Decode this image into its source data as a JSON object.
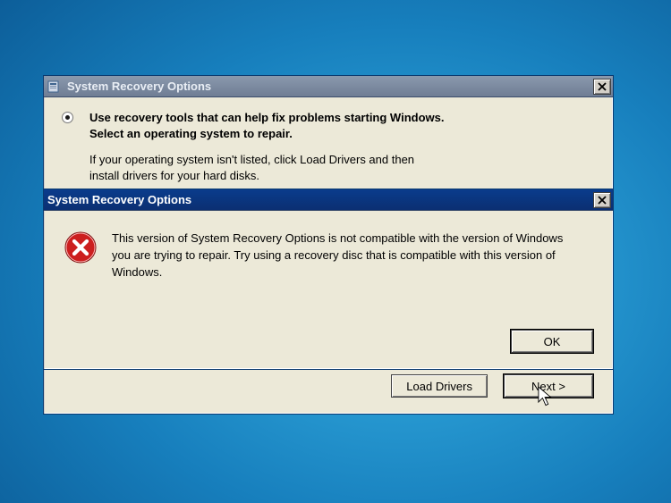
{
  "parent_window": {
    "title": "System Recovery Options",
    "option_bold_line1": "Use recovery tools that can help fix problems starting Windows.",
    "option_bold_line2": "Select an operating system to repair.",
    "option_help_line1": "If your operating system isn't listed, click Load Drivers and then",
    "option_help_line2": "install drivers for your hard disks.",
    "buttons": {
      "load_drivers": "Load Drivers",
      "next": "Next >"
    }
  },
  "modal": {
    "title": "System Recovery Options",
    "message": "This version of System Recovery Options is not compatible with the version of Windows you are trying to repair. Try using a recovery disc that is compatible with this version of Windows.",
    "ok": "OK"
  }
}
